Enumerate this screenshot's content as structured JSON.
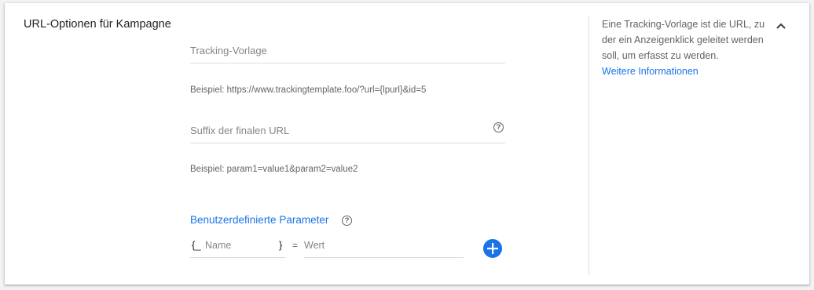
{
  "section": {
    "title": "URL-Optionen für Kampagne"
  },
  "tracking_template": {
    "placeholder": "Tracking-Vorlage",
    "hint": "Beispiel: https://www.trackingtemplate.foo/?url={lpurl}&id=5"
  },
  "final_url_suffix": {
    "placeholder": "Suffix der finalen URL",
    "hint": "Beispiel: param1=value1&param2=value2",
    "help_icon": "help-circle-icon"
  },
  "custom_parameters": {
    "label": "Benutzerdefinierte Parameter",
    "help_icon": "help-circle-icon",
    "name_open_brace": "{_",
    "name_placeholder": "Name",
    "name_close_brace": "}",
    "equals": "=",
    "value_placeholder": "Wert",
    "add_icon": "add-circle-icon"
  },
  "info_panel": {
    "text": "Eine Tracking-Vorlage ist die URL, zu der ein Anzeigenklick geleitet werden soll, um erfasst zu werden.",
    "link": "Weitere Informationen"
  },
  "collapse_icon": "chevron-up-icon",
  "colors": {
    "accent": "#1a73e8",
    "text_primary": "#202124",
    "text_secondary": "#5f6368",
    "divider": "#dadce0"
  }
}
